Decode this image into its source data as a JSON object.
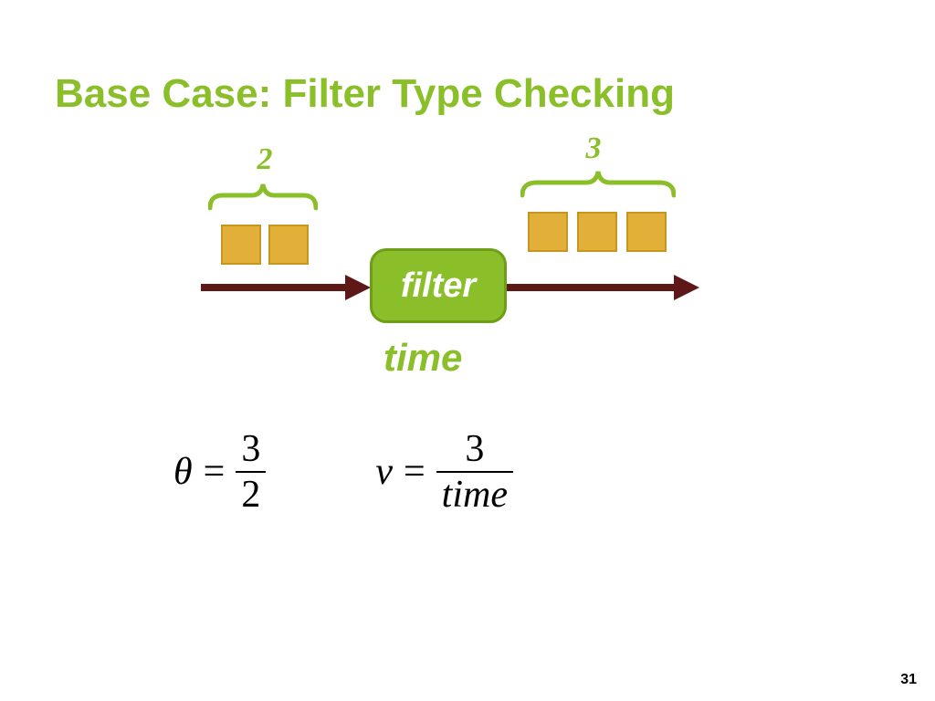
{
  "colors": {
    "accent": "#8bbf2a",
    "arrow": "#5e1818",
    "packet_fill": "#e2b038",
    "packet_border": "#c79620"
  },
  "title": "Base Case: Filter Type Checking",
  "page_number": "31",
  "diagram": {
    "left_count_label": "2",
    "right_count_label": "3",
    "node_label": "filter",
    "time_label": "time"
  },
  "equations": {
    "theta": {
      "lhs": "θ",
      "eq": "=",
      "num": "3",
      "den": "2"
    },
    "nu": {
      "lhs": "ν",
      "eq": "=",
      "num": "3",
      "den": "time"
    }
  }
}
